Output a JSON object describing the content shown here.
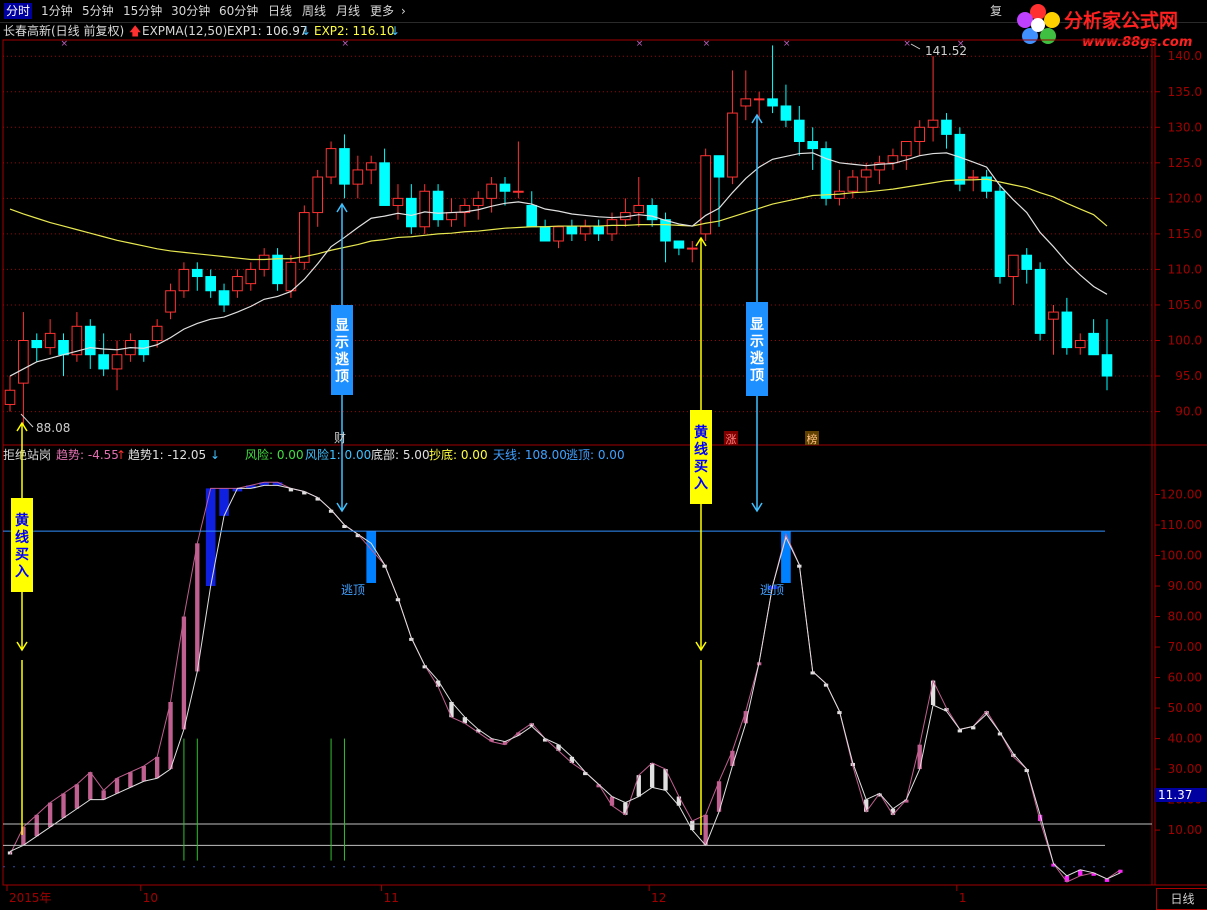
{
  "toolbar": {
    "tabs": [
      "分时",
      "1分钟",
      "5分钟",
      "15分钟",
      "30分钟",
      "60分钟",
      "日线",
      "周线",
      "月线",
      "更多"
    ],
    "active": "分时",
    "more_icon": "chevron-right-icon",
    "restore_label": "复"
  },
  "brand": {
    "name": "分析家公式网",
    "url": "www.88gs.com",
    "color": "#ff2020",
    "flower_colors": [
      "#ff3030",
      "#ffd000",
      "#40c040",
      "#4090ff",
      "#c040ff"
    ]
  },
  "main_info": {
    "title": "长春高新(日线 前复权)",
    "indicator": "EXPMA(12,50)",
    "exp1_label": "EXP1: 106.97",
    "exp2_label": "EXP2: 116.10",
    "exp1_color": "#e0e0e0",
    "exp2_color": "#ffff40"
  },
  "lower_info": {
    "title": "拒绝站岗",
    "items": [
      {
        "text": "趋势: -4.55",
        "color": "#e070b0"
      },
      {
        "text": "趋势1: -12.05",
        "color": "#e0e0e0"
      },
      {
        "text": "风险: 0.00",
        "color": "#40e040"
      },
      {
        "text": "风险1: 0.00",
        "color": "#40c0ff"
      },
      {
        "text": "底部: 5.00",
        "color": "#e0e0e0"
      },
      {
        "text": "抄底: 0.00",
        "color": "#ffff40"
      },
      {
        "text": "天线: 108.00",
        "color": "#40a0ff"
      },
      {
        "text": "逃顶: 0.00",
        "color": "#40a0ff"
      }
    ]
  },
  "annotations": {
    "high_label": "141.52",
    "low_label": "88.08",
    "cai_label": "财",
    "zhang_label": "涨",
    "bang_label": "榜",
    "escape_label": "逃顶",
    "escape_label2": "逃顶",
    "box_show_escape": "显示逃顶",
    "box_show_escape2": "显示逃顶",
    "box_yellow_buy": "黄线买入",
    "box_yellow_buy2": "黄线买入",
    "current_value": "11.37",
    "period": "日线"
  },
  "colors": {
    "up": "#ff3232",
    "down": "#00ffff",
    "exp1": "#e0e0e0",
    "exp2": "#e8e850",
    "grid": "#a00000",
    "tian_line": "#3090ff",
    "pink": "#c06090",
    "white": "#e0e0e0",
    "blue": "#1020e0",
    "magenta": "#ff20ff",
    "yellow": "#ffff00",
    "cyan": "#40c0ff"
  },
  "chart_data": [
    {
      "type": "candlestick",
      "ylim": [
        86,
        142
      ],
      "y_ticks": [
        "140.0",
        "135.0",
        "130.0",
        "125.0",
        "120.0",
        "115.0",
        "110.0",
        "105.0",
        "100.0",
        "95.0",
        "90.0"
      ],
      "x_ticks": [
        "2015年",
        "10",
        "11",
        "12",
        "1"
      ],
      "x_tick_index": [
        0,
        10,
        28,
        48,
        71
      ],
      "ohlc": [
        [
          91,
          95,
          90,
          93
        ],
        [
          94,
          104,
          88.08,
          100
        ],
        [
          100,
          101,
          97,
          99
        ],
        [
          99,
          103,
          98,
          101
        ],
        [
          100,
          101,
          95,
          98
        ],
        [
          98,
          104,
          97,
          102
        ],
        [
          102,
          103,
          96,
          98
        ],
        [
          98,
          101,
          95,
          96
        ],
        [
          96,
          100,
          93,
          98
        ],
        [
          98,
          101,
          97,
          100
        ],
        [
          100,
          100,
          97,
          98
        ],
        [
          100,
          103,
          99,
          102
        ],
        [
          104,
          108,
          103,
          107
        ],
        [
          107,
          111,
          106,
          110
        ],
        [
          110,
          111,
          107,
          109
        ],
        [
          109,
          110,
          106,
          107
        ],
        [
          107,
          108,
          104,
          105
        ],
        [
          107,
          110,
          106,
          109
        ],
        [
          108,
          111,
          107,
          110
        ],
        [
          110,
          113,
          109,
          112
        ],
        [
          112,
          113,
          107,
          108
        ],
        [
          107,
          112,
          106,
          111
        ],
        [
          111,
          119,
          110,
          118
        ],
        [
          118,
          124,
          116,
          123
        ],
        [
          123,
          128,
          122,
          127
        ],
        [
          127,
          129,
          120,
          122
        ],
        [
          122,
          126,
          120,
          124
        ],
        [
          124,
          126,
          122,
          125
        ],
        [
          125,
          127,
          119,
          119
        ],
        [
          119,
          122,
          117,
          120
        ],
        [
          120,
          122,
          115,
          116
        ],
        [
          116,
          122,
          115,
          121
        ],
        [
          121,
          122,
          116,
          117
        ],
        [
          117,
          120,
          116,
          118
        ],
        [
          118,
          120,
          116,
          119
        ],
        [
          119,
          121,
          117,
          120
        ],
        [
          120,
          123,
          118,
          122
        ],
        [
          122,
          123,
          119,
          121
        ],
        [
          121,
          128,
          120,
          121
        ],
        [
          119,
          121,
          117,
          116
        ],
        [
          116,
          117,
          114,
          114
        ],
        [
          114,
          116,
          113,
          116
        ],
        [
          116,
          117,
          114,
          115
        ],
        [
          115,
          117,
          114,
          116
        ],
        [
          116,
          117,
          114,
          115
        ],
        [
          115,
          118,
          114,
          117
        ],
        [
          117,
          120,
          116,
          118
        ],
        [
          118,
          123,
          116,
          119
        ],
        [
          119,
          120,
          116,
          117
        ],
        [
          117,
          118,
          111,
          114
        ],
        [
          114,
          114,
          112,
          113
        ],
        [
          113,
          114,
          111,
          113
        ],
        [
          115,
          127,
          114,
          126
        ],
        [
          126,
          126,
          116,
          123
        ],
        [
          123,
          138,
          122,
          132
        ],
        [
          133,
          138,
          131,
          134
        ],
        [
          134,
          135,
          131,
          134
        ],
        [
          134,
          141.52,
          132,
          133
        ],
        [
          133,
          136,
          130,
          131
        ],
        [
          131,
          133,
          126,
          128
        ],
        [
          128,
          130,
          124,
          127
        ],
        [
          127,
          128,
          119,
          120
        ],
        [
          120,
          124,
          119,
          121
        ],
        [
          121,
          124,
          120,
          123
        ],
        [
          123,
          125,
          121,
          124
        ],
        [
          124,
          126,
          122,
          125
        ],
        [
          125,
          127,
          124,
          126
        ],
        [
          126,
          127,
          124,
          128
        ],
        [
          128,
          131,
          126,
          130
        ],
        [
          130,
          140,
          128,
          131
        ],
        [
          131,
          132,
          127,
          129
        ],
        [
          129,
          130,
          121,
          122
        ],
        [
          123,
          124,
          121,
          123
        ],
        [
          123,
          124,
          120,
          121
        ],
        [
          121,
          122,
          108,
          109
        ],
        [
          109,
          112,
          105,
          112
        ],
        [
          112,
          113,
          108,
          110
        ],
        [
          110,
          111,
          100,
          101
        ],
        [
          103,
          105,
          98,
          104
        ],
        [
          104,
          106,
          98,
          99
        ],
        [
          99,
          101,
          98,
          100
        ],
        [
          101,
          103,
          98,
          98
        ],
        [
          98,
          103,
          93,
          95
        ]
      ],
      "exp1": [
        95,
        96,
        97,
        97.5,
        98,
        98.5,
        99,
        98.8,
        98.7,
        99,
        98.9,
        99.4,
        100.4,
        101.6,
        102.4,
        103,
        103.3,
        104,
        104.8,
        105.8,
        106.2,
        106.9,
        108.6,
        110.8,
        113.2,
        114.5,
        115.9,
        117.2,
        117.5,
        117.9,
        117.6,
        118.1,
        117.9,
        118,
        118.1,
        118.4,
        118.9,
        119.3,
        119.5,
        119.2,
        118.5,
        118.2,
        117.8,
        117.6,
        117.4,
        117.3,
        117.4,
        117.7,
        117.5,
        116.9,
        116.4,
        116.1,
        117.6,
        118.6,
        120.8,
        122.8,
        124.4,
        125.5,
        125.9,
        126.3,
        126.4,
        125.6,
        125,
        124.8,
        124.6,
        124.8,
        124.9,
        125.4,
        126,
        126.3,
        126.4,
        125.8,
        125.1,
        124.4,
        121.8,
        119.8,
        118,
        115.2,
        113.2,
        111,
        109.2,
        107.6,
        106.5
      ],
      "exp2": [
        118.5,
        117.8,
        117.2,
        116.6,
        116.1,
        115.6,
        115.1,
        114.6,
        114.1,
        113.7,
        113.3,
        112.9,
        112.6,
        112.4,
        112.2,
        112,
        111.8,
        111.6,
        111.4,
        111.4,
        111.5,
        111.5,
        111.8,
        112.2,
        112.7,
        113.1,
        113.5,
        114,
        114.2,
        114.5,
        114.6,
        114.8,
        115,
        115.1,
        115.3,
        115.4,
        115.6,
        115.8,
        115.9,
        116,
        116,
        116.1,
        116.1,
        116.1,
        116.1,
        116.2,
        116.2,
        116.3,
        116.3,
        116.3,
        116.2,
        116.1,
        116.5,
        116.8,
        117.4,
        118,
        118.6,
        119.2,
        119.6,
        120,
        120.4,
        120.5,
        120.6,
        120.8,
        120.9,
        121.1,
        121.3,
        121.6,
        121.9,
        122.2,
        122.5,
        122.6,
        122.6,
        122.7,
        122.3,
        121.9,
        121.5,
        120.8,
        120.2,
        119.3,
        118.5,
        117.7,
        116.1
      ]
    },
    {
      "type": "bar",
      "title": "拒绝站岗",
      "ylim": [
        -8,
        130
      ],
      "y_ticks": [
        "120.00",
        "110.00",
        "100.00",
        "90.00",
        "80.00",
        "70.00",
        "60.00",
        "50.00",
        "40.00",
        "30.00",
        "20.00",
        "10.00"
      ],
      "tian_line": 108,
      "ref_lines": [
        12,
        0
      ],
      "trend": [
        2,
        11,
        15,
        19,
        22,
        25,
        29,
        23,
        27,
        29,
        31,
        34,
        52,
        80,
        104,
        122,
        122,
        122,
        123,
        124,
        124,
        122,
        121,
        119,
        115,
        110,
        107,
        102,
        97,
        86,
        73,
        64,
        57,
        47,
        45,
        42,
        39,
        38,
        42,
        45,
        40,
        36,
        32,
        29,
        25,
        18,
        15,
        28,
        32,
        30,
        21,
        13,
        15,
        26,
        36,
        49,
        65,
        90,
        107,
        97,
        62,
        58,
        49,
        31,
        16,
        22,
        15,
        20,
        38,
        59,
        50,
        43,
        44,
        49,
        42,
        34,
        30,
        13,
        -1,
        -7,
        -5,
        -4,
        -6,
        -3
      ],
      "trend1": [
        3,
        5,
        8,
        11,
        14,
        17,
        20,
        20,
        22,
        24,
        26,
        27,
        30,
        43,
        62,
        90,
        113,
        122,
        122,
        123,
        123,
        122,
        121,
        119,
        115,
        110,
        107,
        104,
        97,
        86,
        73,
        64,
        59,
        52,
        47,
        43,
        40,
        39,
        41,
        44,
        40,
        38,
        34,
        29,
        25,
        21,
        19,
        21,
        24,
        23,
        18,
        10,
        5,
        16,
        31,
        45,
        65,
        90,
        106,
        97,
        62,
        58,
        49,
        32,
        20,
        22,
        17,
        20,
        30,
        51,
        49,
        43,
        44,
        48,
        42,
        35,
        30,
        15,
        -1,
        -5,
        -3,
        -4,
        -6,
        -4
      ],
      "bar_colors": [
        "w",
        "p",
        "p",
        "p",
        "p",
        "p",
        "p",
        "p",
        "p",
        "p",
        "p",
        "p",
        "p",
        "p",
        "p",
        "b",
        "b",
        "b",
        "b",
        "b",
        "b",
        "w",
        "w",
        "w",
        "w",
        "w",
        "w",
        "c",
        "w",
        "w",
        "w",
        "w",
        "w",
        "w",
        "w",
        "w",
        "p",
        "p",
        "p",
        "w",
        "w",
        "w",
        "w",
        "w",
        "p",
        "p",
        "w",
        "w",
        "w",
        "w",
        "w",
        "w",
        "p",
        "p",
        "p",
        "p",
        "p",
        "b",
        "c",
        "w",
        "w",
        "w",
        "w",
        "w",
        "w",
        "w",
        "w",
        "p",
        "p",
        "w",
        "w",
        "w",
        "w",
        "w",
        "w",
        "w",
        "w",
        "m",
        "m",
        "m",
        "m",
        "m",
        "m",
        "m"
      ],
      "green_lines": [
        13,
        14,
        24,
        25
      ],
      "yellow_lines": [
        1,
        52
      ],
      "escape_index": [
        25,
        57
      ]
    }
  ]
}
